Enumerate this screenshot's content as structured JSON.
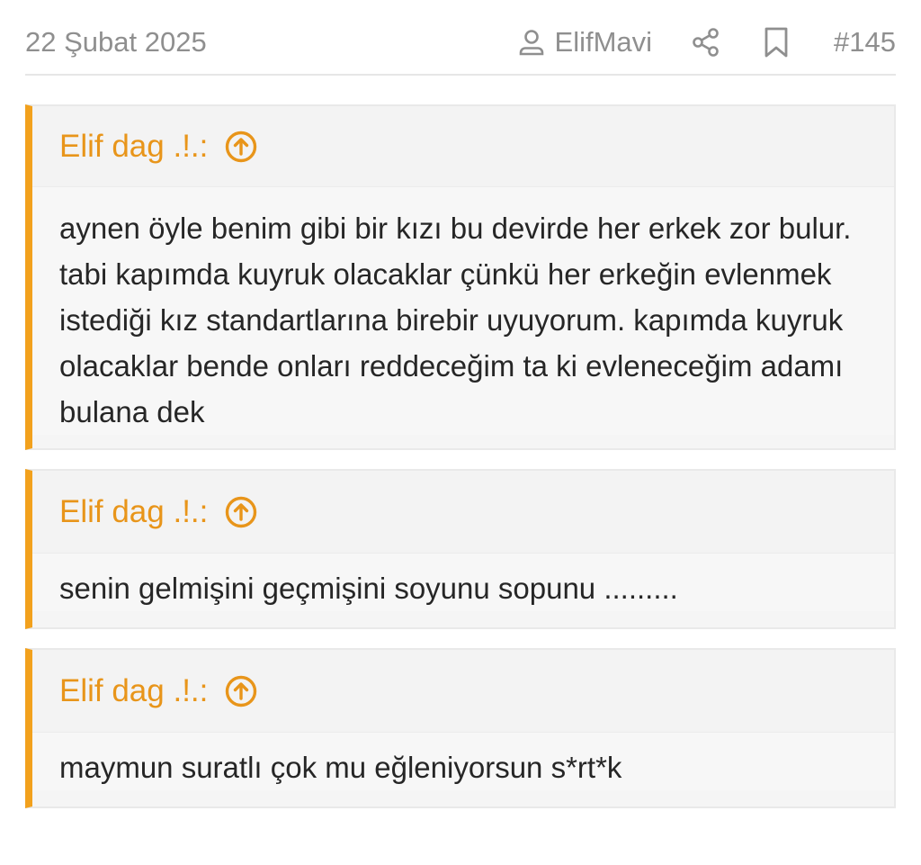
{
  "header": {
    "date": "22 Şubat 2025",
    "author": "ElifMavi",
    "post_number": "#145",
    "icons": [
      "user-icon",
      "share-icon",
      "bookmark-icon"
    ]
  },
  "quotes": [
    {
      "author": "Elif dag .!.:",
      "text": "aynen öyle benim gibi bir kızı bu devirde her erkek zor bulur. tabi kapımda kuyruk olacaklar çünkü her erkeğin evlenmek istediği kız standartlarına birebir uyuyorum. kapımda kuyruk olacaklar bende onları reddeceğim ta ki evleneceğim adamı bulana dek"
    },
    {
      "author": "Elif dag .!.:",
      "text": "senin gelmişini geçmişini soyunu sopunu ........."
    },
    {
      "author": "Elif dag .!.:",
      "text": "maymun suratlı çok mu eğleniyorsun s*rt*k"
    }
  ],
  "colors": {
    "accent": "#f2a11d",
    "quote_author": "#e8951a",
    "meta_text": "#8f8f8f",
    "quote_bg": "#f5f5f5",
    "body_text": "#262626"
  }
}
